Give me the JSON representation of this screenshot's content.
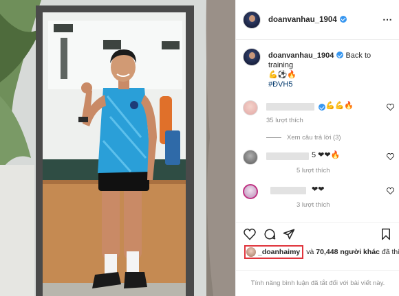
{
  "post": {
    "username": "doanvanhau_1904",
    "caption": "Back to training",
    "caption_emojis": "💪⚽🔥",
    "hashtag": "#ĐVH5"
  },
  "header": {
    "more_icon": "⋯"
  },
  "comments": [
    {
      "text_suffix": "💪💪🔥",
      "likes": "35 lượt thích",
      "avatar_color": "#e8b4b0"
    },
    {
      "text_suffix": "5 ❤❤🔥",
      "likes": "5 lượt thích",
      "avatar_color": "#8c8c8c"
    },
    {
      "text_suffix": "❤❤",
      "likes": "3 lượt thích",
      "avatar_color": "#c9a3c6"
    }
  ],
  "view_replies": "Xem câu trả lời (3)",
  "likes": {
    "liker": "_doanhaimy",
    "and": "và",
    "others": "70,448 người khác",
    "suffix": "đã thích"
  },
  "footer_text": "Tính năng bình luận đã tắt đối với bài viết này.",
  "colors": {
    "verified": "#3897f0",
    "highlight": "#e0343c",
    "jersey": "#2a9fd8"
  }
}
